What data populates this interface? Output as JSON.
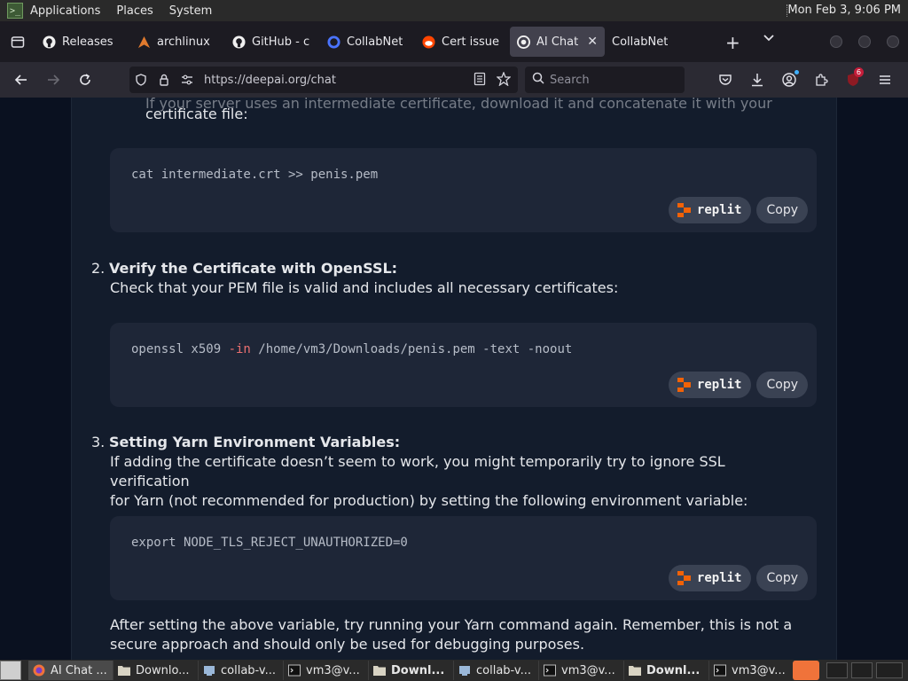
{
  "system_panel": {
    "menus": [
      "Applications",
      "Places",
      "System"
    ],
    "clock": "Mon Feb  3,  9:06 PM"
  },
  "tabs": [
    {
      "label": "Releases",
      "icon": "github-icon"
    },
    {
      "label": "archlinux",
      "icon": "archlinux-icon"
    },
    {
      "label": "GitHub - c",
      "icon": "github-icon"
    },
    {
      "label": "CollabNet",
      "icon": "collabnet-icon"
    },
    {
      "label": "Cert issue",
      "icon": "reddit-icon"
    },
    {
      "label": "AI Chat",
      "icon": "deepai-icon",
      "active": true
    },
    {
      "label": "CollabNet",
      "icon": "collabnet-icon"
    }
  ],
  "navigation": {
    "url": "https://deepai.org/chat",
    "search_placeholder": "Search",
    "extension_badge": "6"
  },
  "content": {
    "intro_fragment": "If your server uses an intermediate certificate, download it and concatenate it with your",
    "intro_line2": "certificate file:",
    "code_blocks": [
      {
        "code_parts": [
          "cat intermediate.crt >> penis.pem"
        ]
      },
      {
        "code_parts": [
          "openssl x509 ",
          "-in",
          " /home/vm3/Downloads/penis.pem -text -noout"
        ]
      },
      {
        "code_parts": [
          "export NODE_TLS_REJECT_UNAUTHORIZED=0"
        ]
      }
    ],
    "replit_label": "replit",
    "copy_label": "Copy",
    "steps": [
      {
        "number": "2.",
        "title": "Verify the Certificate with OpenSSL:",
        "desc": "Check that your PEM file is valid and includes all necessary certificates:"
      },
      {
        "number": "3.",
        "title": "Setting Yarn Environment Variables:",
        "desc_line1": "If adding the certificate doesn’t seem to work, you might temporarily try to ignore SSL verification",
        "desc_line2": "for Yarn (not recommended for production) by setting the following environment variable:"
      }
    ],
    "after_line1": "After setting the above variable, try running your Yarn command again. Remember, this is not a",
    "after_line2": "secure approach and should only be used for debugging purposes."
  },
  "taskbar": {
    "items": [
      {
        "label": "AI Chat ...",
        "icon": "firefox-icon",
        "active": true
      },
      {
        "label": "Downlo...",
        "icon": "folder-icon"
      },
      {
        "label": "collab-v...",
        "icon": "vm-icon"
      },
      {
        "label": "vm3@v...",
        "icon": "terminal-icon"
      },
      {
        "label": "Downl...",
        "icon": "folder-icon",
        "bold": true
      },
      {
        "label": "collab-v...",
        "icon": "vm-icon"
      },
      {
        "label": "vm3@v...",
        "icon": "terminal-icon"
      },
      {
        "label": "Downl...",
        "icon": "folder-icon",
        "bold": true
      },
      {
        "label": "vm3@v...",
        "icon": "terminal-icon"
      }
    ]
  },
  "colors": {
    "page_bg": "#0a1120",
    "column_bg": "#131c2c",
    "code_bg": "#1e2637",
    "replit_orange": "#f26207"
  }
}
